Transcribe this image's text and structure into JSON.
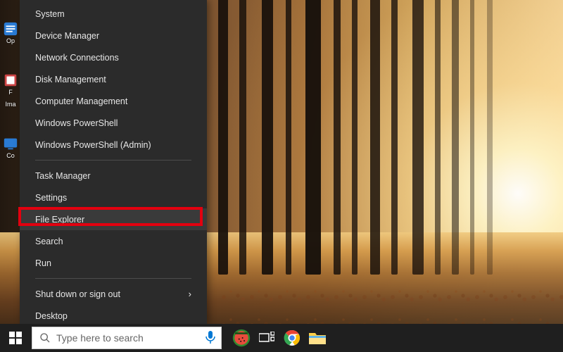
{
  "desktop": {
    "icons": [
      {
        "label": "Op"
      },
      {
        "label": "F"
      },
      {
        "label": "Ima"
      },
      {
        "label": "Co"
      }
    ]
  },
  "winx_menu": {
    "groups": [
      {
        "items": [
          {
            "key": "system",
            "label": "System"
          },
          {
            "key": "device-manager",
            "label": "Device Manager"
          },
          {
            "key": "network-connections",
            "label": "Network Connections"
          },
          {
            "key": "disk-management",
            "label": "Disk Management"
          },
          {
            "key": "computer-management",
            "label": "Computer Management"
          },
          {
            "key": "powershell",
            "label": "Windows PowerShell"
          },
          {
            "key": "powershell-admin",
            "label": "Windows PowerShell (Admin)"
          }
        ]
      },
      {
        "items": [
          {
            "key": "task-manager",
            "label": "Task Manager"
          },
          {
            "key": "settings",
            "label": "Settings"
          },
          {
            "key": "file-explorer",
            "label": "File Explorer",
            "highlighted": true,
            "hovered": true
          },
          {
            "key": "search",
            "label": "Search"
          },
          {
            "key": "run",
            "label": "Run"
          }
        ]
      },
      {
        "items": [
          {
            "key": "shutdown",
            "label": "Shut down or sign out",
            "submenu": true
          },
          {
            "key": "desktop",
            "label": "Desktop"
          }
        ]
      }
    ]
  },
  "taskbar": {
    "search_placeholder": "Type here to search",
    "icons": [
      {
        "key": "watermelon",
        "name": "watermelon-icon"
      },
      {
        "key": "task-view",
        "name": "task-view-icon"
      },
      {
        "key": "chrome",
        "name": "chrome-icon"
      },
      {
        "key": "file-explorer",
        "name": "file-explorer-icon"
      }
    ]
  },
  "colors": {
    "menu_bg": "#2b2b2b",
    "menu_text": "#e6e6e6",
    "taskbar_bg": "#1f1f1f",
    "highlight_border": "#e3000f"
  }
}
